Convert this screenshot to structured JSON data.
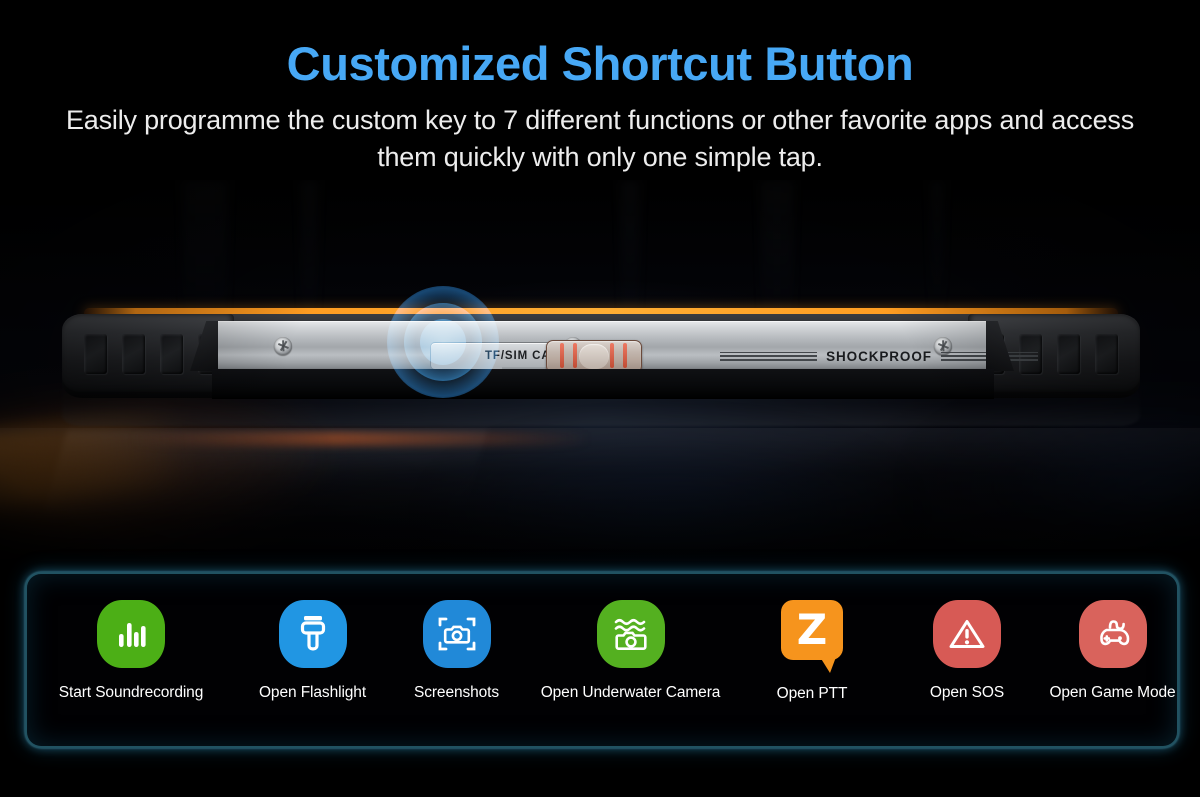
{
  "header": {
    "title": "Customized Shortcut Button",
    "subtitle": "Easily programme the custom key to 7 different functions or other favorite apps and access them quickly with only one simple tap.",
    "title_color": "#47a8f5",
    "subtitle_color": "#ededed"
  },
  "device": {
    "sim_label": "TF/SIM CARD",
    "shockproof_label": "SHOCKPROOF",
    "accent_color": "#ff9d22",
    "highlight_glow_color": "#2e96f0",
    "button_name": "custom-shortcut-key"
  },
  "panel": {
    "border_color": "#3c96af",
    "background_color": "#010103",
    "shortcuts": [
      {
        "label": "Start Soundrecording",
        "icon": "sound-recorder-icon",
        "color": "#4caf16"
      },
      {
        "label": "Open Flashlight",
        "icon": "flashlight-icon",
        "color": "#2196e3"
      },
      {
        "label": "Screenshots",
        "icon": "screenshot-camera-icon",
        "color": "#2189d8"
      },
      {
        "label": "Open Underwater Camera",
        "icon": "underwater-camera-icon",
        "color": "#54b020"
      },
      {
        "label": "Open PTT",
        "icon": "ptt-zello-icon",
        "color": "#f6941d"
      },
      {
        "label": "Open SOS",
        "icon": "sos-warning-icon",
        "color": "#d75a55"
      },
      {
        "label": "Open Game Mode",
        "icon": "game-controller-icon",
        "color": "#d9635c"
      }
    ]
  }
}
